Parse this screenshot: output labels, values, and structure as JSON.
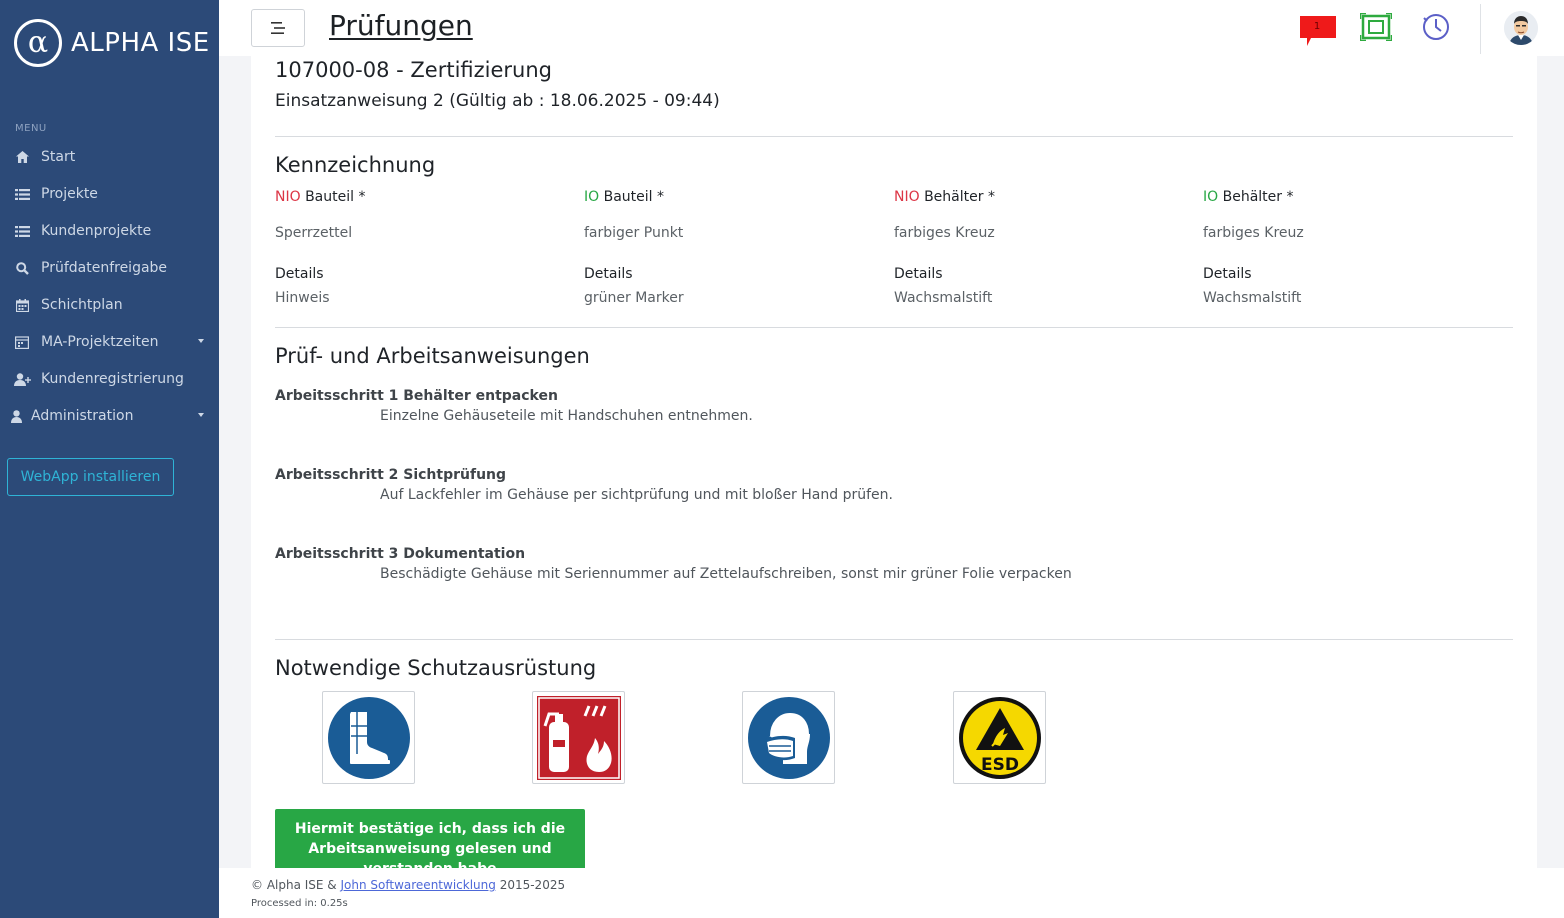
{
  "app": {
    "logo_text": "ALPHA ISE",
    "logo_symbol": "α"
  },
  "sidebar": {
    "menu_label": "MENU",
    "items": [
      {
        "label": "Start",
        "icon": "home-icon"
      },
      {
        "label": "Projekte",
        "icon": "list-icon"
      },
      {
        "label": "Kundenprojekte",
        "icon": "list-icon"
      },
      {
        "label": "Prüfdatenfreigabe",
        "icon": "search-icon"
      },
      {
        "label": "Schichtplan",
        "icon": "calendar-icon"
      },
      {
        "label": "MA-Projektzeiten",
        "icon": "calendar-grid-icon"
      },
      {
        "label": "Kundenregistrierung",
        "icon": "user-add-icon"
      },
      {
        "label": "Administration",
        "icon": "user-icon"
      }
    ],
    "install_button": "WebApp installieren"
  },
  "header": {
    "title": "Prüfungen",
    "notification_count": "1"
  },
  "main": {
    "title": "107000-08 - Zertifizierung",
    "subtitle": "Einsatzanweisung 2 (Gültig ab : 18.06.2025 - 09:44)",
    "kennzeichnung": {
      "heading": "Kennzeichnung",
      "columns": [
        {
          "prefix": "NIO",
          "label": "Bauteil *",
          "value": "Sperrzettel",
          "details_label": "Details",
          "details_value": "Hinweis"
        },
        {
          "prefix": "IO",
          "label": "Bauteil *",
          "value": "farbiger Punkt",
          "details_label": "Details",
          "details_value": "grüner Marker"
        },
        {
          "prefix": "NIO",
          "label": "Behälter *",
          "value": "farbiges Kreuz",
          "details_label": "Details",
          "details_value": "Wachsmalstift"
        },
        {
          "prefix": "IO",
          "label": "Behälter *",
          "value": "farbiges Kreuz",
          "details_label": "Details",
          "details_value": "Wachsmalstift"
        }
      ]
    },
    "anweisungen": {
      "heading": "Prüf- und Arbeitsanweisungen",
      "steps": [
        {
          "title": "Arbeitsschritt 1 Behälter entpacken",
          "description": "Einzelne Gehäuseteile mit Handschuhen entnehmen."
        },
        {
          "title": "Arbeitsschritt 2 Sichtprüfung",
          "description": "Auf Lackfehler im Gehäuse per sichtprüfung und mit bloßer Hand prüfen."
        },
        {
          "title": "Arbeitsschritt 3 Dokumentation",
          "description": "Beschädigte Gehäuse mit Seriennummer auf Zettelaufschreiben, sonst mir grüner Folie verpacken"
        }
      ]
    },
    "schutz": {
      "heading": "Notwendige Schutzausrüstung",
      "items": [
        "safety-boots-icon",
        "fire-extinguisher-icon",
        "face-mask-icon",
        "esd-warning-icon"
      ],
      "esd_text": "ESD"
    },
    "confirm_button": "Hiermit bestätige ich, dass ich die Arbeitsanweisung gelesen und verstanden habe"
  },
  "footer": {
    "copyright_prefix": "© Alpha ISE &",
    "company_link": "John Softwareentwicklung",
    "years": "2015-2025",
    "processed": "Processed in: 0.25s"
  },
  "colors": {
    "sidebar": "#2c4a78",
    "accent_green": "#28a745",
    "nio_red": "#dc3545",
    "io_green": "#28a745",
    "install_cyan": "#2fb4d6",
    "mandatory_blue": "#1a5c96"
  }
}
